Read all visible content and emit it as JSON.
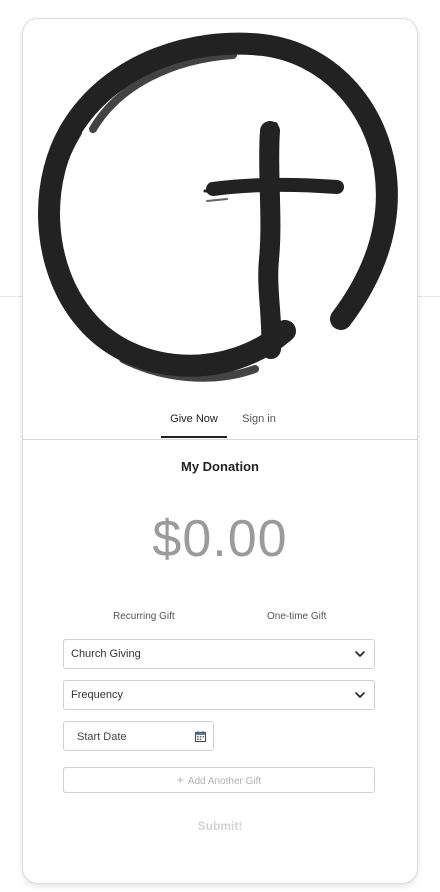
{
  "logo": {
    "name": "church-cross-circle-logo"
  },
  "tabs": [
    {
      "label": "Give Now",
      "active": true
    },
    {
      "label": "Sign in",
      "active": false
    }
  ],
  "donation": {
    "title": "My Donation",
    "amount": "$0.00"
  },
  "gift_types": {
    "recurring": "Recurring Gift",
    "one_time": "One-time Gift"
  },
  "fund_select": {
    "value": "Church Giving",
    "icon": "chevron-down-icon"
  },
  "frequency_select": {
    "value": "Frequency",
    "icon": "chevron-down-icon"
  },
  "start_date": {
    "placeholder": "Start Date",
    "icon": "calendar-icon"
  },
  "add_gift": {
    "label": "Add Another Gift",
    "icon": "plus-icon"
  },
  "submit": {
    "label": "Submit!"
  },
  "colors": {
    "text": "#2b2b2b",
    "amount": "#9b9b9b",
    "disabled": "#d3d3d3",
    "border": "#cfcfcf",
    "logo": "#222222"
  }
}
